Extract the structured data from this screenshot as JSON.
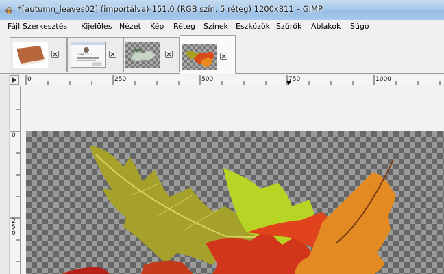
{
  "window": {
    "title": "*[autumn_leaves02] (importálva)-151.0 (RGB szín, 5 réteg) 1200x811 – GIMP"
  },
  "menu": {
    "items": [
      {
        "label": "Fájl"
      },
      {
        "label": "Szerkesztés"
      },
      {
        "label": "Kijelölés"
      },
      {
        "label": "Nézet"
      },
      {
        "label": "Kép"
      },
      {
        "label": "Réteg"
      },
      {
        "label": "Színek"
      },
      {
        "label": "Eszközök"
      },
      {
        "label": "Szűrők"
      },
      {
        "label": "Ablakok"
      },
      {
        "label": "Súgó"
      }
    ]
  },
  "tabs": [
    {
      "thumbnail": "wooden-book-image",
      "active": false
    },
    {
      "thumbnail": "gimp-about-dialog",
      "active": false
    },
    {
      "thumbnail": "transparent-logo",
      "active": false
    },
    {
      "thumbnail": "autumn-leaves",
      "active": true
    }
  ],
  "tab_thumb_text": "GIMP 2.8.14",
  "rulers": {
    "horizontal": [
      "0",
      "250",
      "500",
      "750",
      "1000"
    ],
    "vertical": [
      "0",
      "250"
    ]
  },
  "colors": {
    "titlebar": "#a9c9ea",
    "checker_dark": "#666666",
    "checker_light": "#9a9a9a"
  }
}
